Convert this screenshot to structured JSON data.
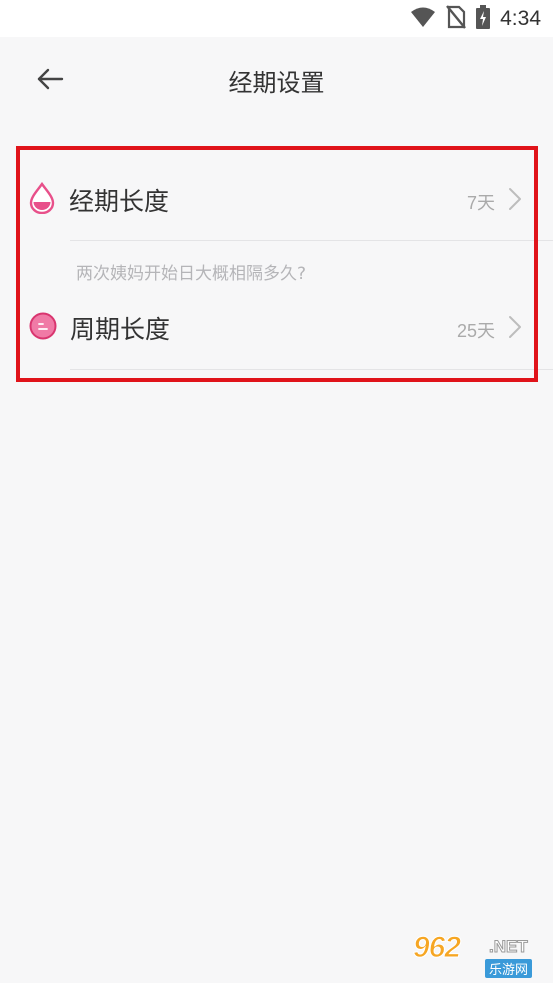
{
  "status_bar": {
    "time": "4:34",
    "icons": [
      "wifi-icon",
      "no-sim-icon",
      "battery-charging-icon"
    ]
  },
  "header": {
    "back_icon": "arrow-left-icon",
    "title": "经期设置"
  },
  "settings": {
    "period_length": {
      "icon": "droplet-icon",
      "label": "经期长度",
      "value": "7天"
    },
    "cycle_hint": "两次姨妈开始日大概相隔多久?",
    "cycle_length": {
      "icon": "face-circle-icon",
      "label": "周期长度",
      "value": "25天"
    }
  },
  "colors": {
    "accent_pink": "#e8508a",
    "highlight_red": "#e0131a",
    "background": "#f7f7f8"
  },
  "watermark": {
    "main": "962",
    "net": ".NET",
    "sub": "乐游网"
  }
}
